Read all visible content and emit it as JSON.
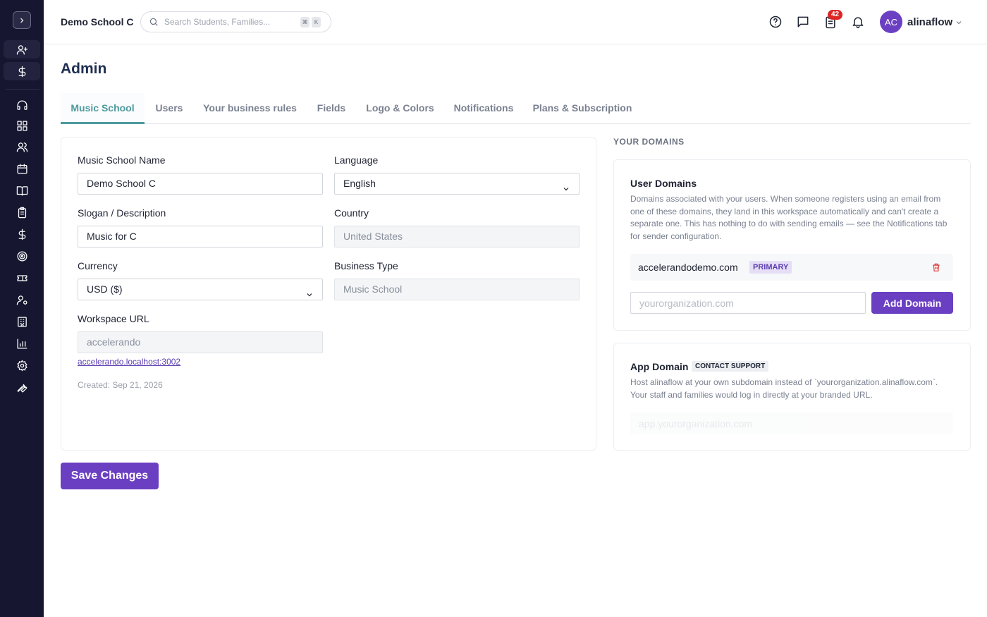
{
  "header": {
    "school_name": "Demo School C",
    "search_placeholder": "Search Students, Families...",
    "shortcut_keys": [
      "⌘",
      "K"
    ],
    "notification_count": "42",
    "user": {
      "initials": "AC",
      "name": "alinaflow"
    }
  },
  "sidebar": {
    "items": [
      {
        "icon": "user-plus-icon"
      },
      {
        "icon": "dollar-icon"
      },
      {
        "icon": "headset-icon"
      },
      {
        "icon": "dashboard-icon"
      },
      {
        "icon": "users-icon"
      },
      {
        "icon": "calendar-icon"
      },
      {
        "icon": "book-icon"
      },
      {
        "icon": "clipboard-icon"
      },
      {
        "icon": "dollar-icon"
      },
      {
        "icon": "target-icon"
      },
      {
        "icon": "ticket-icon"
      },
      {
        "icon": "user-settings-icon"
      },
      {
        "icon": "building-icon"
      },
      {
        "icon": "bar-chart-icon"
      },
      {
        "icon": "gear-icon"
      },
      {
        "icon": "wrench-icon"
      }
    ]
  },
  "page": {
    "title": "Admin",
    "tabs": [
      {
        "label": "Music School"
      },
      {
        "label": "Users"
      },
      {
        "label": "Your business rules"
      },
      {
        "label": "Fields"
      },
      {
        "label": "Logo & Colors"
      },
      {
        "label": "Notifications"
      },
      {
        "label": "Plans & Subscription"
      }
    ]
  },
  "form": {
    "school_name_label": "Music School Name",
    "school_name_value": "Demo School C",
    "language_label": "Language",
    "language_value": "English",
    "slogan_label": "Slogan / Description",
    "slogan_value": "Music for C",
    "country_label": "Country",
    "country_value": "United States",
    "currency_label": "Currency",
    "currency_value": "USD ($)",
    "business_type_label": "Business Type",
    "business_type_value": "Music School",
    "workspace_url_label": "Workspace URL",
    "workspace_url_value": "accelerando",
    "workspace_link": "accelerando.localhost:3002",
    "created": "Created: Sep 21, 2026",
    "save_label": "Save Changes"
  },
  "domains": {
    "section_title": "YOUR DOMAINS",
    "user_domains_title": "User Domains",
    "user_domains_desc": "Domains associated with your users. When someone registers using an email from one of these domains, they land in this workspace automatically and can't create a separate one. This has nothing to do with sending emails — see the Notifications tab for sender configuration.",
    "domain_name": "accelerandodemo.com",
    "primary_tag": "PRIMARY",
    "domain_input_placeholder": "yourorganization.com",
    "add_domain_label": "Add Domain",
    "app_domain_title": "App Domain",
    "contact_support_tag": "CONTACT SUPPORT",
    "app_domain_desc": "Host alinaflow at your own subdomain instead of `yourorganization.alinaflow.com`. Your staff and families would log in directly at your branded URL.",
    "app_input_placeholder": "app.yourorganization.com"
  }
}
